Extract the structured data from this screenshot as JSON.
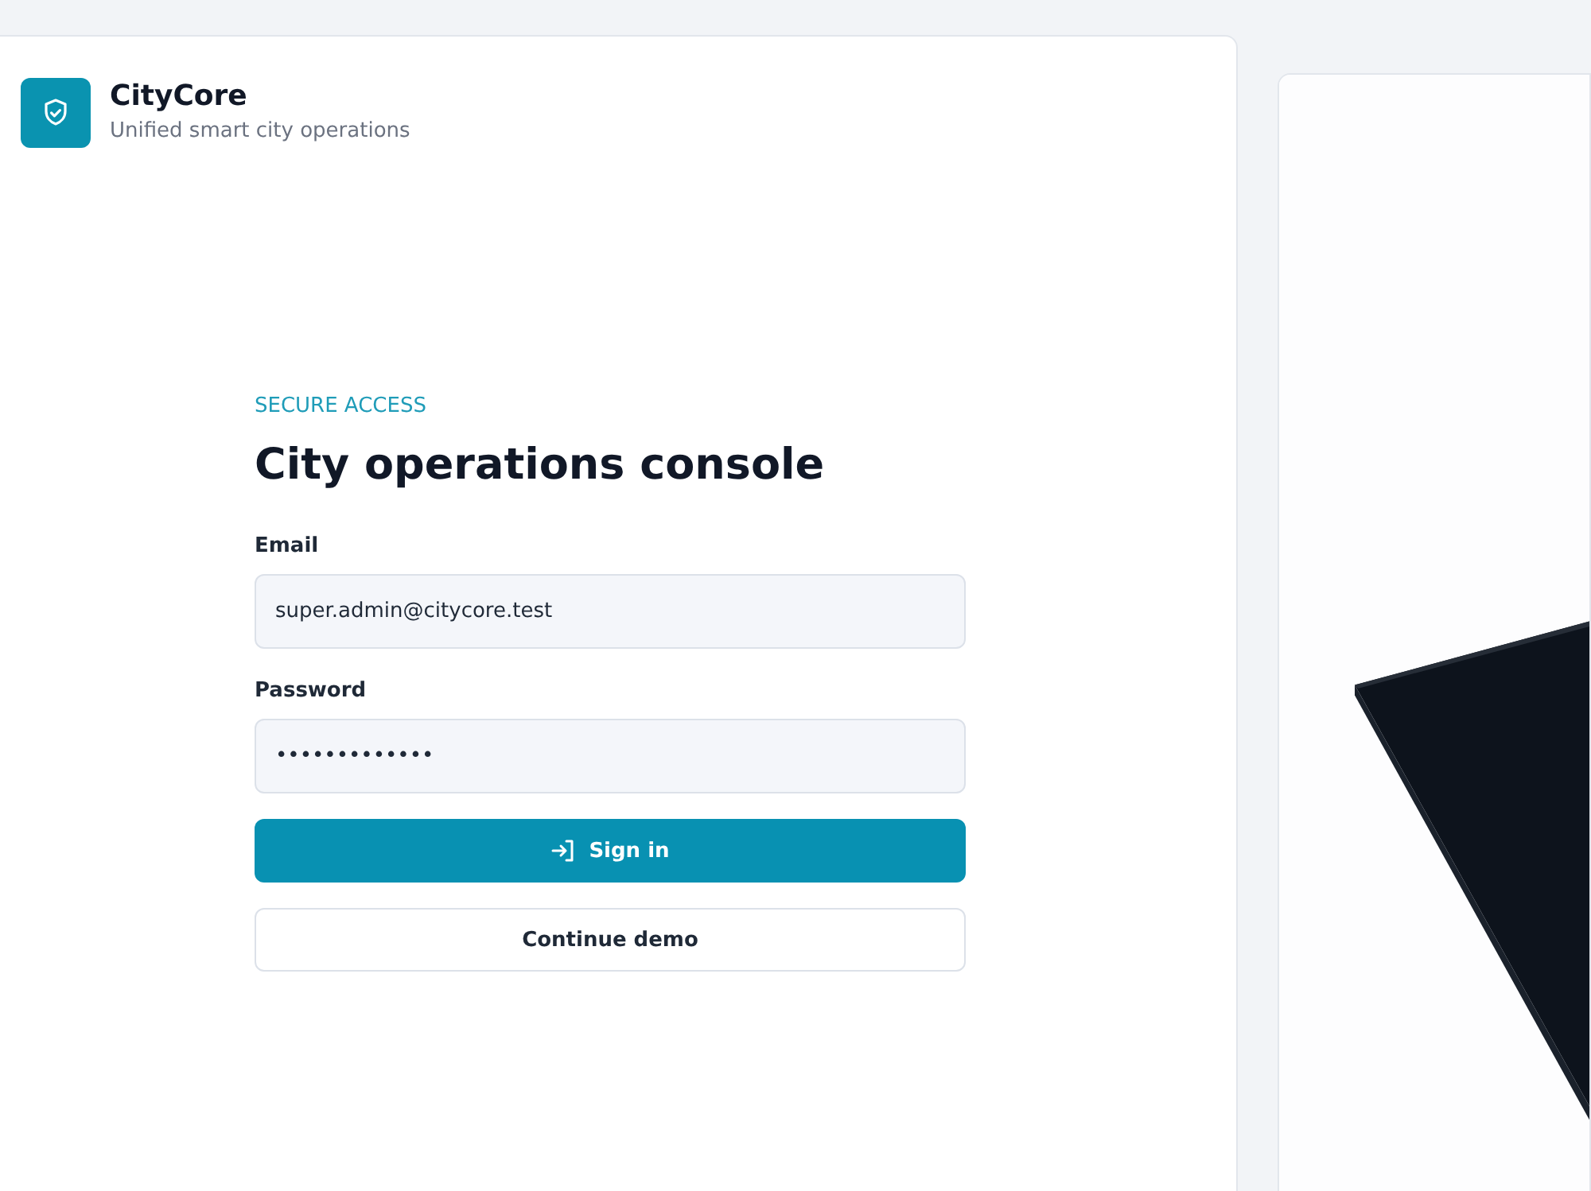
{
  "brand": {
    "name": "CityCore",
    "tagline": "Unified smart city operations"
  },
  "form": {
    "eyebrow": "SECURE ACCESS",
    "title": "City operations console",
    "fields": [
      {
        "label": "Email",
        "value": "super.admin@citycore.test"
      },
      {
        "label": "Password",
        "value": "•••••••••••••"
      }
    ],
    "buttons": [
      {
        "label": "Sign in",
        "kind": "primary"
      },
      {
        "label": "Continue demo",
        "kind": "secondary"
      }
    ]
  }
}
